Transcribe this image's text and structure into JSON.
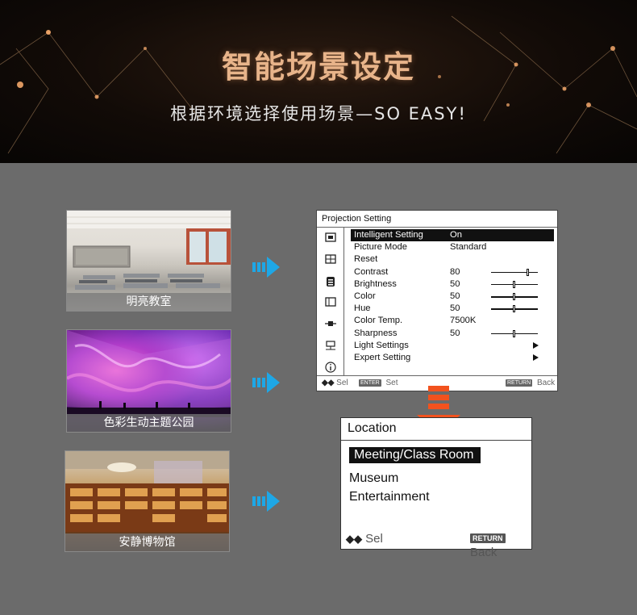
{
  "header": {
    "title": "智能场景设定",
    "subtitle": "根据环境选择使用场景—SO EASY!"
  },
  "scenes": [
    {
      "caption": "明亮教室"
    },
    {
      "caption": "色彩生动主题公园"
    },
    {
      "caption": "安静博物馆"
    }
  ],
  "projection_setting": {
    "title": "Projection Setting",
    "rows": [
      {
        "label": "Intelligent Setting",
        "value": "On"
      },
      {
        "label": "Picture Mode",
        "value": "Standard"
      },
      {
        "label": "Reset",
        "value": ""
      },
      {
        "label": "Contrast",
        "value": "80",
        "level": 0.8
      },
      {
        "label": "Brightness",
        "value": "50",
        "level": 0.5
      },
      {
        "label": "Color",
        "value": "50",
        "level": 0.5
      },
      {
        "label": "Hue",
        "value": "50",
        "level": 0.5
      },
      {
        "label": "Color Temp.",
        "value": "7500K"
      },
      {
        "label": "Sharpness",
        "value": "50",
        "level": 0.5
      },
      {
        "label": "Light Settings",
        "value": ""
      },
      {
        "label": "Expert Setting",
        "value": ""
      }
    ],
    "footer": {
      "sel_label": "Sel",
      "enter_key": "ENTER",
      "set_label": "Set",
      "return_key": "RETURN",
      "back_label": "Back"
    }
  },
  "location": {
    "title": "Location",
    "items": [
      "Meeting/Class Room",
      "Museum",
      "Entertainment"
    ],
    "footer": {
      "sel_label": "Sel",
      "return_key": "RETURN",
      "back_label": "Back"
    }
  },
  "colors": {
    "accent_arrow": "#1ea7e6",
    "down_arrow": "#f2521e",
    "title": "#e8b48a"
  }
}
